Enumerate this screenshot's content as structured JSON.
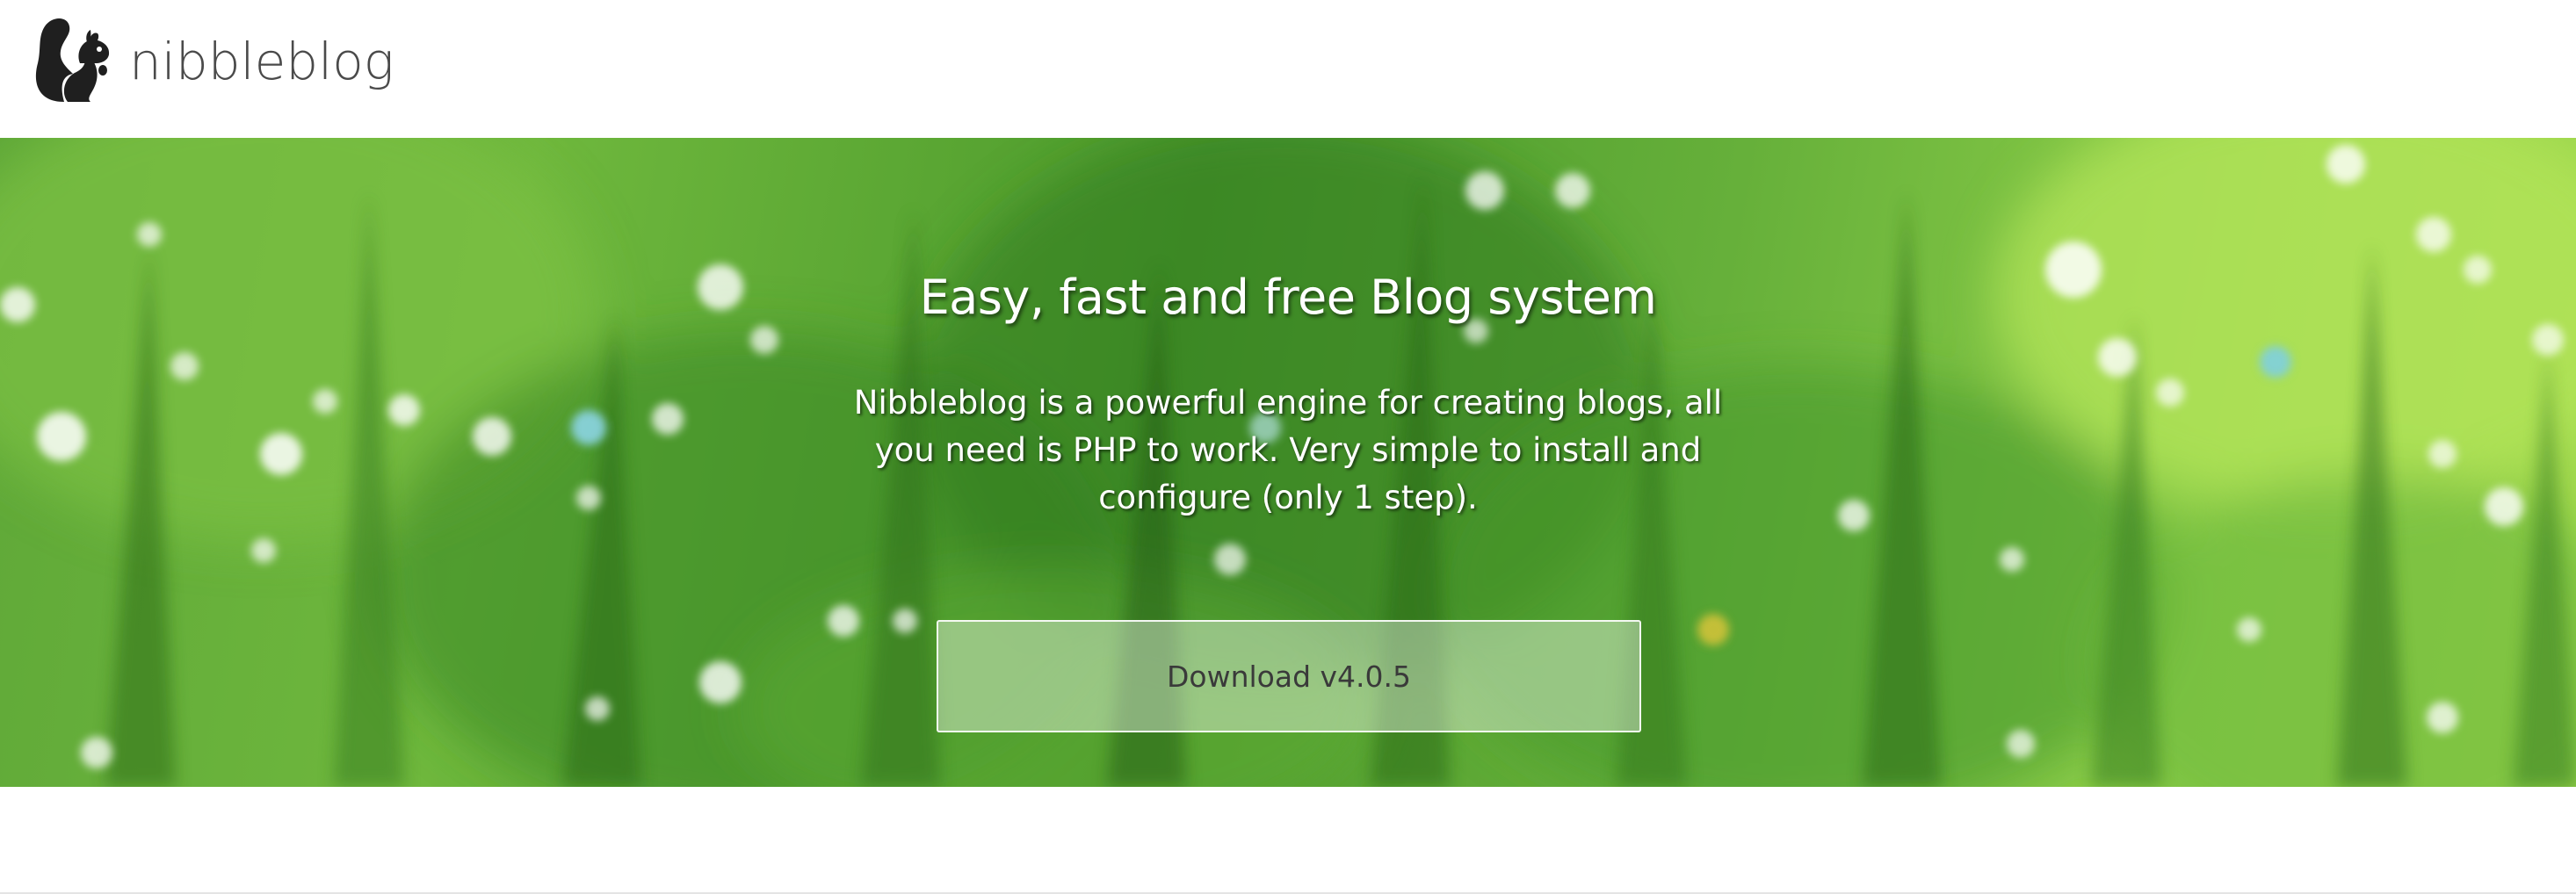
{
  "header": {
    "brand_name": "nibbleblog",
    "logo_icon": "squirrel-logo-icon"
  },
  "hero": {
    "title": "Easy, fast and free Blog system",
    "description": "Nibbleblog is a powerful engine for creating blogs, all you need is PHP to work. Very simple to install and configure (only 1 step).",
    "download_label": "Download v4.0.5",
    "background": "blurred-green-grass-photo"
  },
  "colors": {
    "brand_text": "#4a4a4a",
    "hero_text": "#ffffff",
    "button_text": "#3a3a3a",
    "grass_green": "#5fa838"
  }
}
